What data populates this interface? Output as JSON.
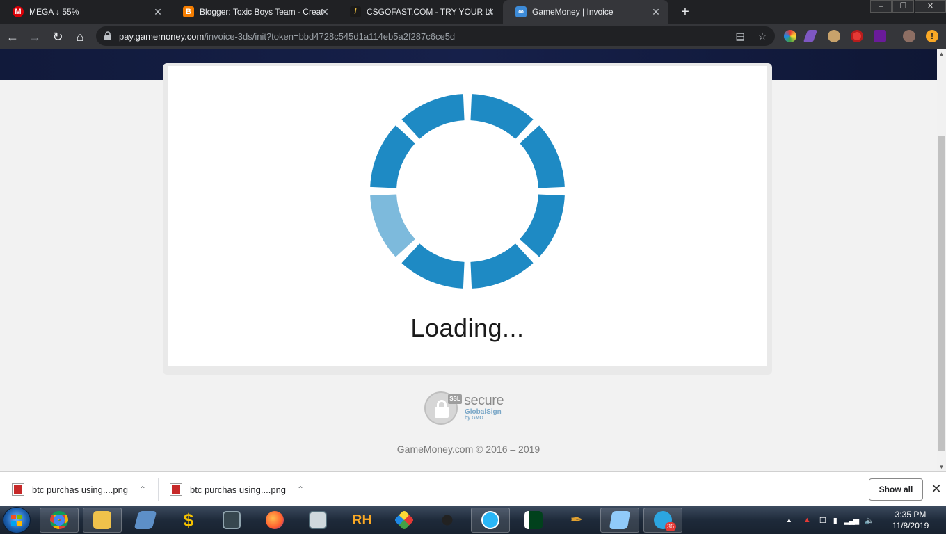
{
  "browser": {
    "tabs": [
      {
        "title": "MEGA ↓ 55%",
        "icon": "mega-icon",
        "color": "#d90007",
        "glyph": "M"
      },
      {
        "title": "Blogger: Toxic Boys Team - Creat",
        "icon": "blogger-icon",
        "color": "#f57d00",
        "glyph": "B"
      },
      {
        "title": "CSGOFAST.COM - TRY YOUR LUC",
        "icon": "csgofast-icon",
        "color": "#1a1a1a",
        "glyph": "/"
      },
      {
        "title": "GameMoney | Invoice",
        "icon": "gamemoney-icon",
        "color": "#3d8bd8",
        "glyph": "∞"
      }
    ],
    "new_tab": "+",
    "window_controls": {
      "minimize": "–",
      "maximize": "❐",
      "close": "✕"
    },
    "address": {
      "host": "pay.gamemoney.com",
      "path": "/invoice-3ds/init?token=bbd4728c545d1a114eb5a2f287c6ce5d"
    }
  },
  "page": {
    "loading_text": "Loading...",
    "ssl_seal": {
      "badge": "SSL",
      "secure": "secure",
      "provider": "GlobalSign",
      "by": "by GMO"
    },
    "copyright": "GameMoney.com © 2016 – 2019",
    "spinner_colors": {
      "active": "#1e8ac4",
      "dim": "#7dbadc"
    }
  },
  "downloads": {
    "items": [
      {
        "name": "btc purchas using....png"
      },
      {
        "name": "btc purchas using....png"
      }
    ],
    "show_all": "Show all",
    "close": "✕"
  },
  "taskbar": {
    "apps": [
      "chrome-icon",
      "explorer-icon",
      "app-icon",
      "money-icon",
      "monitor-icon",
      "firefox-icon",
      "notepad-icon",
      "rh-icon",
      "game-icon",
      "spider-icon",
      "play-icon",
      "pakistan-flag-icon",
      "pen-icon",
      "mail-icon",
      "telegram-icon"
    ],
    "telegram_badge": "36",
    "clock": {
      "time": "3:35 PM",
      "date": "11/8/2019"
    }
  }
}
